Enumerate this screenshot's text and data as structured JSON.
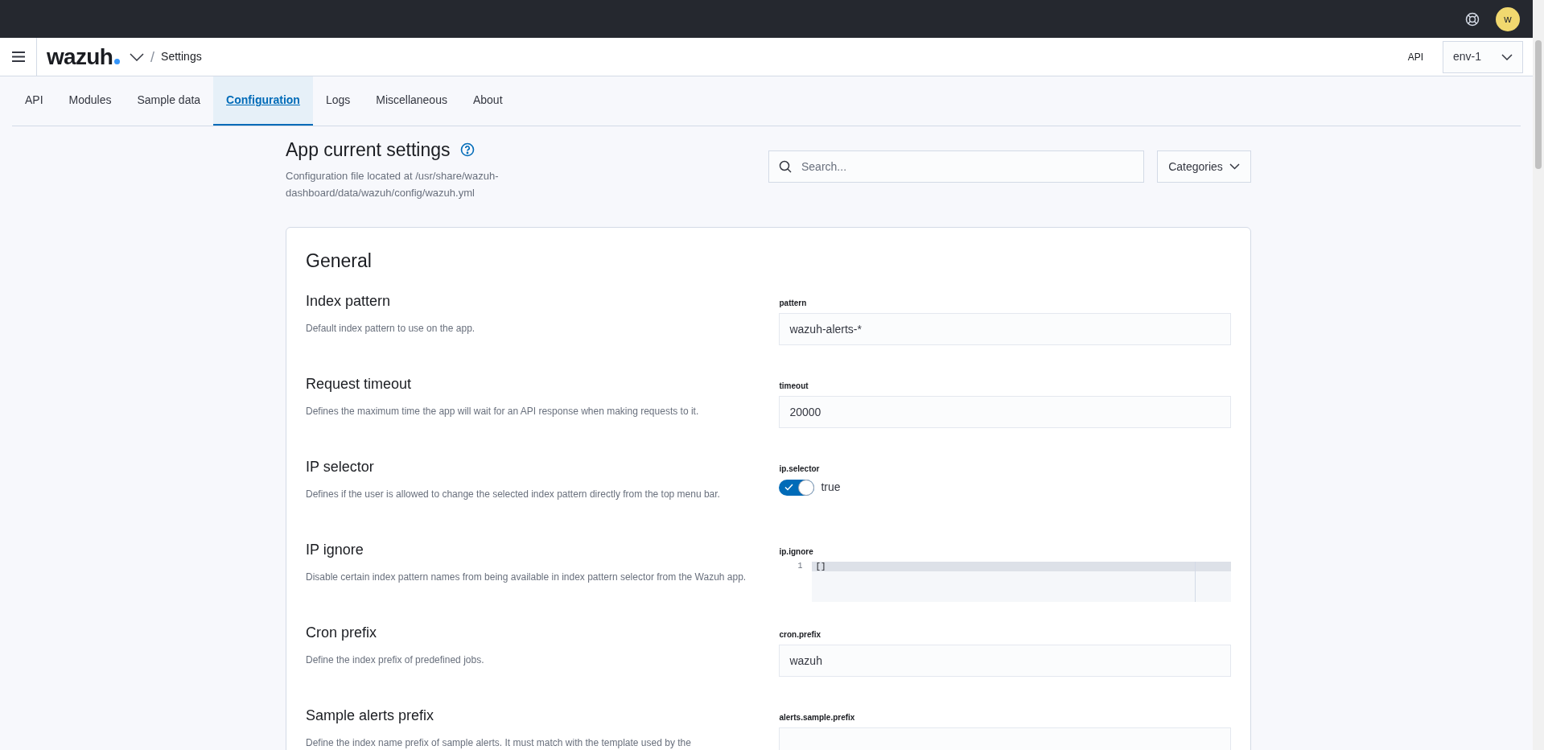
{
  "top_bar": {
    "avatar": "w"
  },
  "header": {
    "logo": "wazuh",
    "separator": "/",
    "breadcrumb": "Settings",
    "api_label": "API",
    "api_select": "env-1"
  },
  "tabs": [
    {
      "label": "API",
      "selected": false
    },
    {
      "label": "Modules",
      "selected": false
    },
    {
      "label": "Sample data",
      "selected": false
    },
    {
      "label": "Configuration",
      "selected": true
    },
    {
      "label": "Logs",
      "selected": false
    },
    {
      "label": "Miscellaneous",
      "selected": false
    },
    {
      "label": "About",
      "selected": false
    }
  ],
  "page": {
    "title": "App current settings",
    "subtitle": "Configuration file located at /usr/share/wazuh-dashboard/data/wazuh/config/wazuh.yml",
    "search": {
      "placeholder": "Search..."
    },
    "categories_button": "Categories"
  },
  "section": {
    "title": "General",
    "settings": [
      {
        "kind": "text",
        "title": "Index pattern",
        "description": "Default index pattern to use on the app.",
        "key": "pattern",
        "value": "wazuh-alerts-*"
      },
      {
        "kind": "text",
        "title": "Request timeout",
        "description": "Defines the maximum time the app will wait for an API response when making requests to it.",
        "key": "timeout",
        "value": "20000"
      },
      {
        "kind": "switch",
        "title": "IP selector",
        "description": "Defines if the user is allowed to change the selected index pattern directly from the top menu bar.",
        "key": "ip.selector",
        "on": true,
        "value": "true"
      },
      {
        "kind": "code",
        "title": "IP ignore",
        "description": "Disable certain index pattern names from being available in index pattern selector from the Wazuh app.",
        "key": "ip.ignore",
        "line_number": "1",
        "value": "[]"
      },
      {
        "kind": "text",
        "title": "Cron prefix",
        "description": "Define the index prefix of predefined jobs.",
        "key": "cron.prefix",
        "value": "wazuh"
      },
      {
        "kind": "text",
        "title": "Sample alerts prefix",
        "description": "Define the index name prefix of sample alerts. It must match with the template used by the",
        "key": "alerts.sample.prefix"
      }
    ]
  }
}
